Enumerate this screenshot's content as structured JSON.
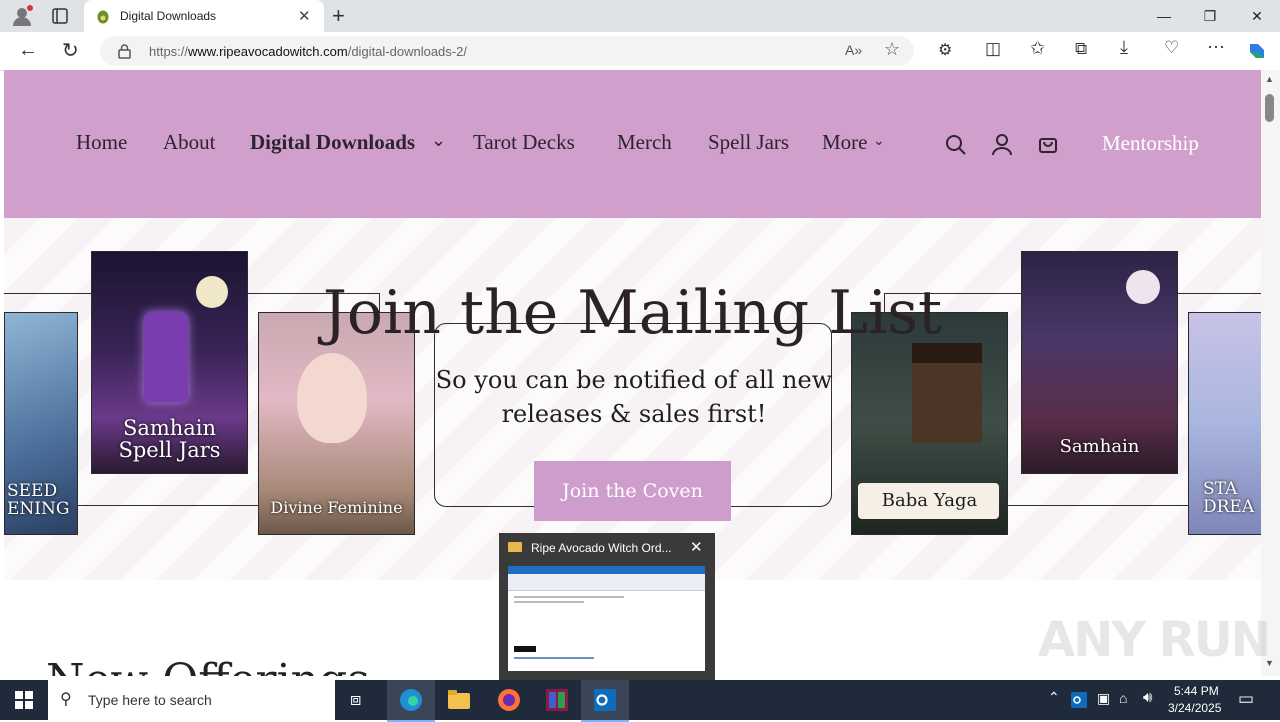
{
  "browser": {
    "tab_title": "Digital Downloads",
    "url_prefix": "https://",
    "url_host": "www.ripeavocadowitch.com",
    "url_path": "/digital-downloads-2/",
    "read_aloud_icon": "A»"
  },
  "nav": {
    "items": [
      "Home",
      "About",
      "Digital Downloads",
      "Tarot Decks",
      "Merch",
      "Spell Jars",
      "More"
    ],
    "active": "Digital Downloads",
    "mentorship": "Mentorship"
  },
  "hero": {
    "title": "Join the Mailing List",
    "subtitle": "So you can be notified of all new releases & sales first!",
    "cta": "Join the Coven",
    "cards": {
      "samhain_spell_jars": "Samhain Spell Jars",
      "divine_feminine": "Divine Feminine",
      "baba_yaga": "Baba Yaga",
      "samhain": "Samhain",
      "left_partial": "SEED ENING",
      "right_partial": "STA DREA"
    }
  },
  "section": {
    "heading_partial": "New Offerings"
  },
  "popup": {
    "title": "Ripe Avocado Witch Ord..."
  },
  "taskbar": {
    "search_placeholder": "Type here to search",
    "time": "5:44 PM",
    "date": "3/24/2025"
  },
  "watermark": "ANY RUN",
  "colors": {
    "nav_bg": "#d09fcb",
    "cta_bg": "#cf9dcc",
    "taskbar_bg": "#1f2a3a"
  }
}
